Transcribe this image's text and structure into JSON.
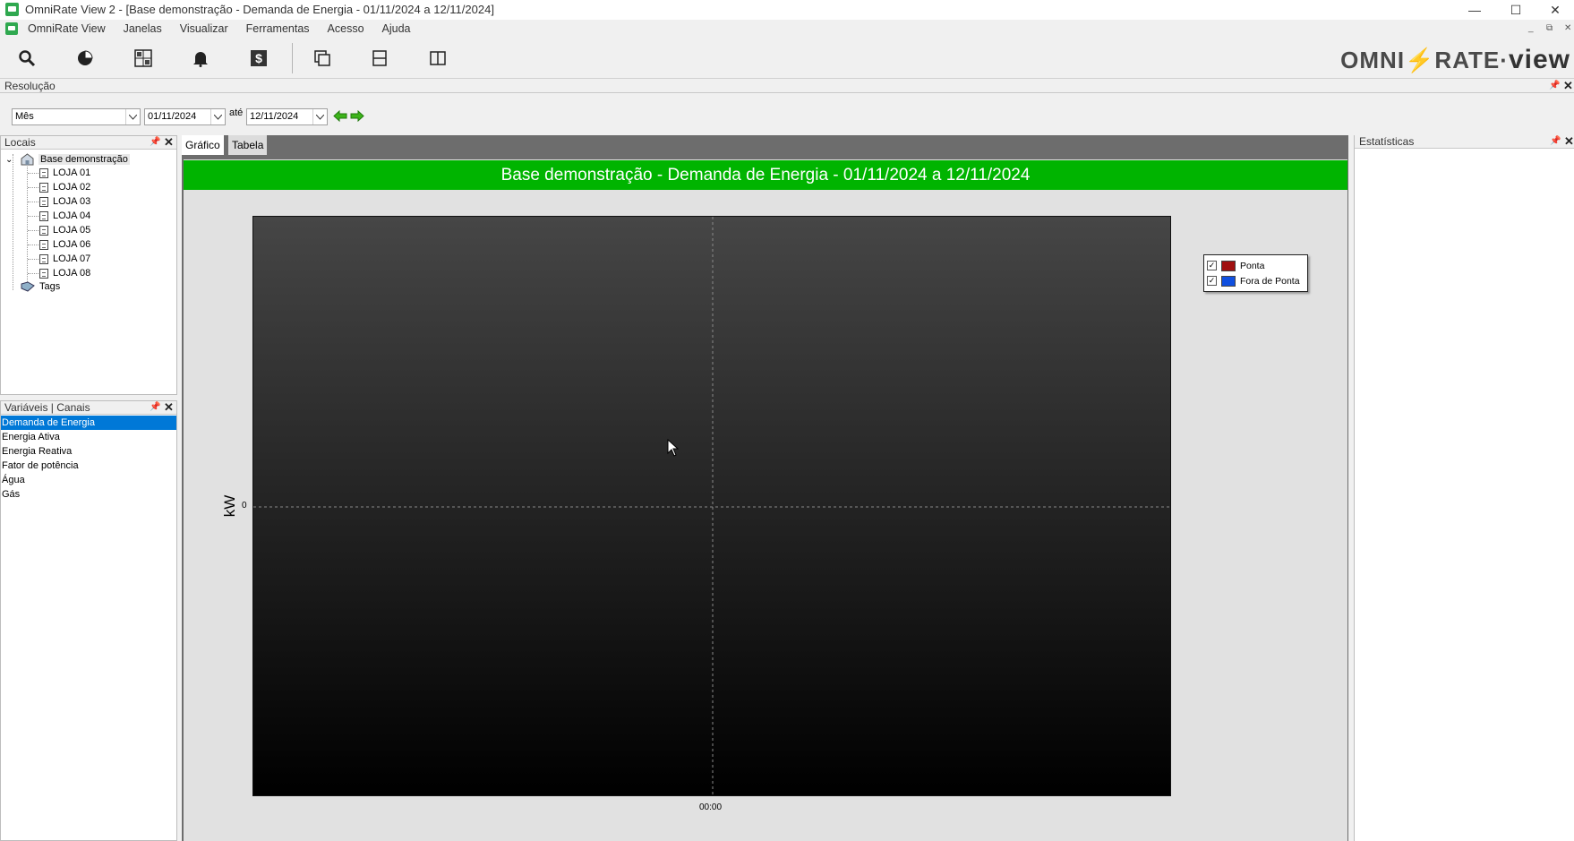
{
  "window": {
    "title": "OmniRate View 2 - [Base demonstração - Demanda de Energia - 01/11/2024 a 12/11/2024]",
    "controls": {
      "minimize": "—",
      "maximize": "☐",
      "close": "✕"
    }
  },
  "menu": {
    "items": [
      "OmniRate View",
      "Janelas",
      "Visualizar",
      "Ferramentas",
      "Acesso",
      "Ajuda"
    ],
    "mdi_controls": {
      "minimize": "_",
      "restore": "⧉",
      "close": "✕"
    }
  },
  "toolbar": {
    "buttons": [
      "search-icon",
      "pie-chart-icon",
      "calculator-grid-icon",
      "bell-icon",
      "dollar-icon",
      "cascade-windows-icon",
      "tile-horizontal-icon",
      "tile-vertical-icon"
    ],
    "logo": {
      "part1": "OMNI",
      "part2": "RATE",
      "part3": "view"
    }
  },
  "resolucao": {
    "header": "Resolução",
    "period_select": "Mês",
    "date_from": "01/11/2024",
    "ate_label": "até",
    "date_to": "12/11/2024"
  },
  "locais": {
    "header": "Locais",
    "root": "Base demonstração",
    "children": [
      "LOJA 01",
      "LOJA 02",
      "LOJA 03",
      "LOJA 04",
      "LOJA 05",
      "LOJA 06",
      "LOJA 07",
      "LOJA 08"
    ],
    "tags": "Tags"
  },
  "variaveis": {
    "header": "Variáveis | Canais",
    "items": [
      "Demanda de Energia",
      "Energia Ativa",
      "Energia Reativa",
      "Fator de potência",
      "Água",
      "Gás"
    ],
    "selected": "Demanda de Energia"
  },
  "tabs": {
    "grafico": "Gráfico",
    "tabela": "Tabela"
  },
  "chart_data": {
    "type": "bar",
    "title": "Base demonstração - Demanda de Energia - 01/11/2024 a 12/11/2024",
    "ylabel": "kW",
    "xlabel": "",
    "x_ticks": [
      "00:00"
    ],
    "y_ticks": [
      "0"
    ],
    "series": [
      {
        "name": "Ponta",
        "color": "#a01010",
        "values": []
      },
      {
        "name": "Fora de Ponta",
        "color": "#1050e0",
        "values": []
      }
    ],
    "grid": true,
    "legend_position": "top-right",
    "title_bg": "#00b400"
  },
  "estatisticas": {
    "header": "Estatísticas"
  }
}
